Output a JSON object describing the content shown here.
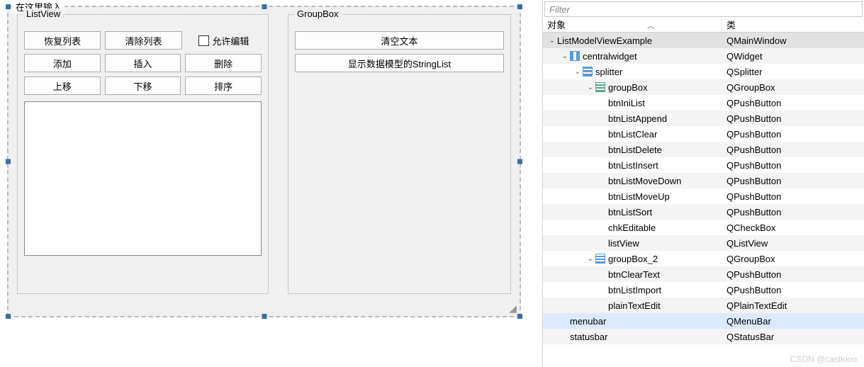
{
  "form": {
    "title": "在这里输入",
    "groupbox_left": {
      "title": "ListView",
      "btn_restore": "恢复列表",
      "btn_clear": "清除列表",
      "chk_editable": "允许编辑",
      "btn_add": "添加",
      "btn_insert": "插入",
      "btn_delete": "删除",
      "btn_moveup": "上移",
      "btn_movedown": "下移",
      "btn_sort": "排序"
    },
    "groupbox_right": {
      "title": "GroupBox",
      "btn_cleartext": "清空文本",
      "btn_showmodel": "显示数据模型的StringList"
    }
  },
  "inspector": {
    "filter_placeholder": "Filter",
    "col_object": "对象",
    "col_class": "类",
    "rows": [
      {
        "indent": 0,
        "exp": "v",
        "icon": "",
        "obj": "ListModelViewExample",
        "cls": "QMainWindow",
        "sel": "root"
      },
      {
        "indent": 1,
        "exp": "v",
        "icon": "layout",
        "obj": "centralwidget",
        "cls": "QWidget"
      },
      {
        "indent": 2,
        "exp": "v",
        "icon": "split",
        "obj": "splitter",
        "cls": "QSplitter"
      },
      {
        "indent": 3,
        "exp": "v",
        "icon": "grid",
        "obj": "groupBox",
        "cls": "QGroupBox"
      },
      {
        "indent": 4,
        "exp": "",
        "icon": "",
        "obj": "btnIniList",
        "cls": "QPushButton"
      },
      {
        "indent": 4,
        "exp": "",
        "icon": "",
        "obj": "btnListAppend",
        "cls": "QPushButton"
      },
      {
        "indent": 4,
        "exp": "",
        "icon": "",
        "obj": "btnListClear",
        "cls": "QPushButton"
      },
      {
        "indent": 4,
        "exp": "",
        "icon": "",
        "obj": "btnListDelete",
        "cls": "QPushButton"
      },
      {
        "indent": 4,
        "exp": "",
        "icon": "",
        "obj": "btnListInsert",
        "cls": "QPushButton"
      },
      {
        "indent": 4,
        "exp": "",
        "icon": "",
        "obj": "btnListMoveDown",
        "cls": "QPushButton"
      },
      {
        "indent": 4,
        "exp": "",
        "icon": "",
        "obj": "btnListMoveUp",
        "cls": "QPushButton"
      },
      {
        "indent": 4,
        "exp": "",
        "icon": "",
        "obj": "btnListSort",
        "cls": "QPushButton"
      },
      {
        "indent": 4,
        "exp": "",
        "icon": "",
        "obj": "chkEditable",
        "cls": "QCheckBox"
      },
      {
        "indent": 4,
        "exp": "",
        "icon": "",
        "obj": "listView",
        "cls": "QListView"
      },
      {
        "indent": 3,
        "exp": "v",
        "icon": "lines",
        "obj": "groupBox_2",
        "cls": "QGroupBox"
      },
      {
        "indent": 4,
        "exp": "",
        "icon": "",
        "obj": "btnClearText",
        "cls": "QPushButton"
      },
      {
        "indent": 4,
        "exp": "",
        "icon": "",
        "obj": "btnListImport",
        "cls": "QPushButton"
      },
      {
        "indent": 4,
        "exp": "",
        "icon": "",
        "obj": "plainTextEdit",
        "cls": "QPlainTextEdit"
      },
      {
        "indent": 1,
        "exp": "",
        "icon": "",
        "obj": "menubar",
        "cls": "QMenuBar",
        "sel": "sel"
      },
      {
        "indent": 1,
        "exp": "",
        "icon": "",
        "obj": "statusbar",
        "cls": "QStatusBar"
      }
    ]
  },
  "watermark": "CSDN @castlooo"
}
